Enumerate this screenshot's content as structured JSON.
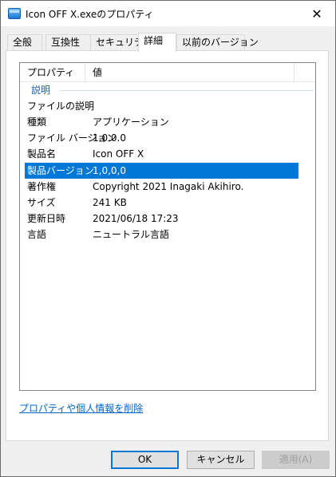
{
  "window": {
    "title": "Icon OFF X.exeのプロパティ",
    "close_glyph": "✕"
  },
  "tabs": [
    {
      "label": "全般"
    },
    {
      "label": "互換性"
    },
    {
      "label": "セキュリティ"
    },
    {
      "label": "詳細"
    },
    {
      "label": "以前のバージョン"
    }
  ],
  "details": {
    "columns": {
      "property": "プロパティ",
      "value": "値"
    },
    "group": "説明",
    "rows": [
      {
        "key": "ファイルの説明",
        "value": ""
      },
      {
        "key": "種類",
        "value": "アプリケーション"
      },
      {
        "key": "ファイル バージョン",
        "value": "1.0.0.0"
      },
      {
        "key": "製品名",
        "value": "Icon OFF X"
      },
      {
        "key": "製品バージョン",
        "value": "1,0,0,0"
      },
      {
        "key": "著作権",
        "value": "Copyright 2021 Inagaki Akihiro."
      },
      {
        "key": "サイズ",
        "value": "241 KB"
      },
      {
        "key": "更新日時",
        "value": "2021/06/18 17:23"
      },
      {
        "key": "言語",
        "value": "ニュートラル言語"
      }
    ]
  },
  "links": {
    "remove_properties": "プロパティや個人情報を削除"
  },
  "buttons": {
    "ok": "OK",
    "cancel": "キャンセル",
    "apply": "適用(A)"
  },
  "colors": {
    "selection": "#0078d7",
    "link": "#0066cc",
    "group": "#1e5dab"
  }
}
